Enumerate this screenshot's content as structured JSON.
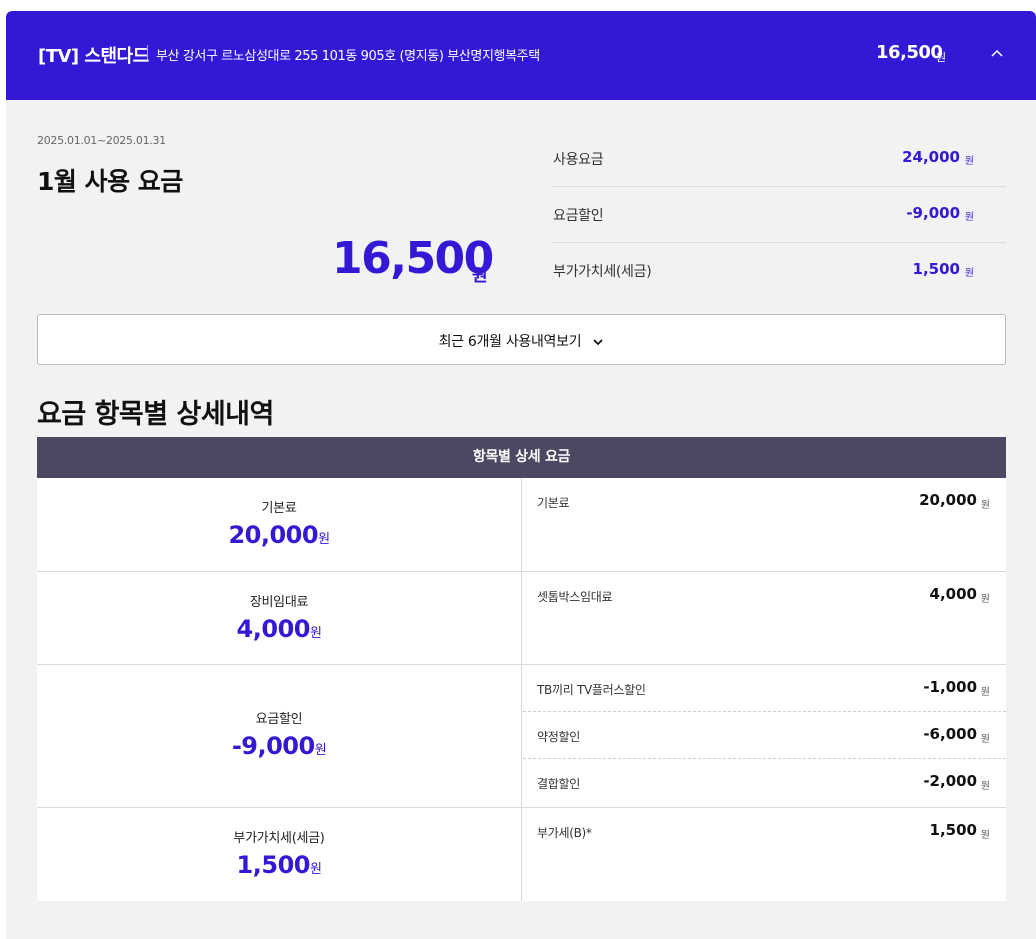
{
  "header": {
    "product": "[TV] 스탠다드",
    "address": "부산 강서구 르노삼성대로 255 101동 905호 (명지동) 부산명지행복주택",
    "amount": "16,500",
    "unit": "원"
  },
  "summary": {
    "period": "2025.01.01~2025.01.31",
    "title": "1월 사용 요금",
    "total": "16,500",
    "total_unit": "원",
    "rows": [
      {
        "label": "사용요금",
        "value": "24,000",
        "unit": "원"
      },
      {
        "label": "요금할인",
        "value": "-9,000",
        "unit": "원"
      },
      {
        "label": "부가가치세(세금)",
        "value": "1,500",
        "unit": "원"
      }
    ]
  },
  "history_button": {
    "label": "최근 6개월 사용내역보기"
  },
  "detail": {
    "section_title": "요금 항목별 상세내역",
    "table_header": "항목별 상세 요금",
    "rows": [
      {
        "category": "기본료",
        "amount": "20,000",
        "unit": "원",
        "items": [
          {
            "name": "기본료",
            "value": "20,000",
            "unit": "원"
          }
        ]
      },
      {
        "category": "장비임대료",
        "amount": "4,000",
        "unit": "원",
        "items": [
          {
            "name": "셋톱박스임대료",
            "value": "4,000",
            "unit": "원"
          }
        ]
      },
      {
        "category": "요금할인",
        "amount": "-9,000",
        "unit": "원",
        "items": [
          {
            "name": "TB끼리 TV플러스할인",
            "value": "-1,000",
            "unit": "원"
          },
          {
            "name": "약정할인",
            "value": "-6,000",
            "unit": "원"
          },
          {
            "name": "결합할인",
            "value": "-2,000",
            "unit": "원"
          }
        ]
      },
      {
        "category": "부가가치세(세금)",
        "amount": "1,500",
        "unit": "원",
        "items": [
          {
            "name": "부가세(B)*",
            "value": "1,500",
            "unit": "원"
          }
        ]
      }
    ]
  },
  "icons": {
    "collapse": "chevron-up-icon",
    "expand": "chevron-down-icon"
  },
  "colors": {
    "accent": "#3318d6",
    "table_header": "#4b4861",
    "background": "#f2f2f2"
  }
}
